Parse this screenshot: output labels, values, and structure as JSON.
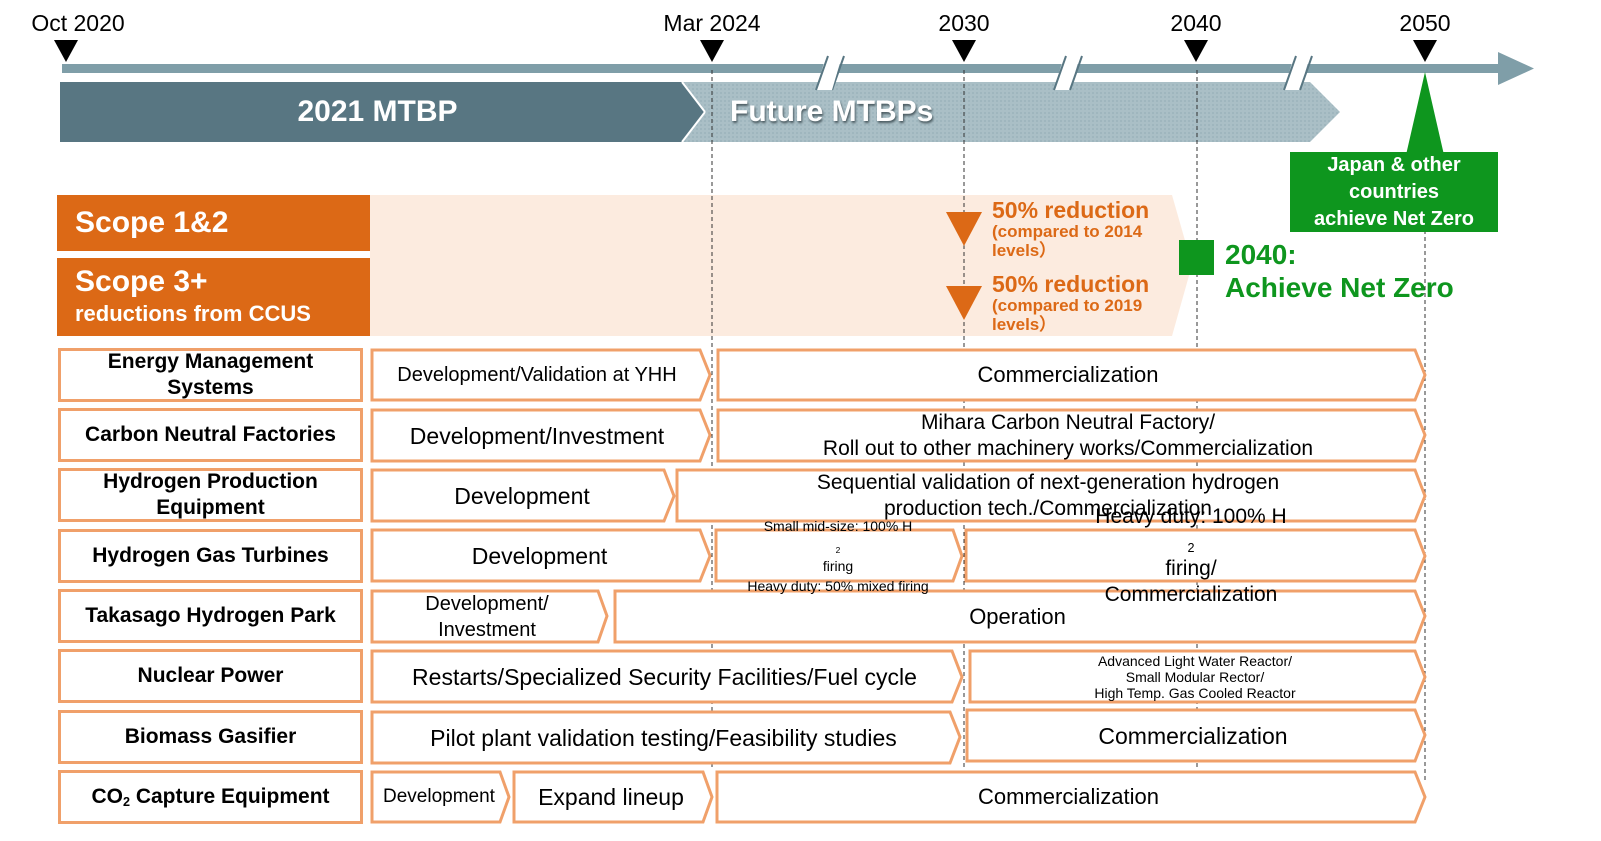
{
  "timeline": {
    "milestones": [
      {
        "label": "Oct 2020"
      },
      {
        "label": "Mar 2024"
      },
      {
        "label": "2030"
      },
      {
        "label": "2040"
      },
      {
        "label": "2050"
      }
    ],
    "axis_breaks": 3
  },
  "plans": {
    "current": "2021 MTBP",
    "future": "Future MTBPs"
  },
  "scopes": {
    "scope12": {
      "title": "Scope 1&2",
      "target_title": "50% reduction",
      "target_note": "(compared to 2014 levels)",
      "target_note_line1": "(compared to 2014",
      "target_note_line2": "levels）"
    },
    "scope3": {
      "title": "Scope 3+",
      "subtitle": "reductions from CCUS",
      "target_title": "50% reduction",
      "target_note_line1": "(compared to 2019",
      "target_note_line2": "levels）"
    }
  },
  "netzero": {
    "company_line1": "2040:",
    "company_line2": "Achieve Net Zero",
    "global_line1": "Japan & other",
    "global_line2": "countries",
    "global_line3": "achieve Net Zero"
  },
  "colors": {
    "scope_orange": "#dc6916",
    "scope_band": "#fcebdf",
    "segment_border": "#f0a06a",
    "current_plan": "#587682",
    "future_plan": "#aabfc6",
    "axis": "#7f9ea8",
    "net_zero_green": "#0e961e"
  },
  "rows": [
    {
      "label_line1": "Energy Management",
      "label_line2": "Systems",
      "segments": [
        {
          "text": "Development/Validation  at YHH"
        },
        {
          "text": "Commercialization"
        }
      ]
    },
    {
      "label_line1": "Carbon Neutral Factories",
      "segments": [
        {
          "text": "Development/Investment"
        },
        {
          "line1": "Mihara Carbon Neutral Factory/",
          "line2": "Roll out to other machinery works/Commercialization"
        }
      ]
    },
    {
      "label_line1": "Hydrogen Production",
      "label_line2": "Equipment",
      "segments": [
        {
          "text": "Development"
        },
        {
          "line1": "Sequential  validation  of next-generation  hydrogen",
          "line2": "production  tech./Commercialization"
        }
      ]
    },
    {
      "label_line1": "Hydrogen Gas Turbines",
      "segments": [
        {
          "text": "Development"
        },
        {
          "line1_pre": "Small mid-size: 100% H",
          "line1_sub": "2",
          "line1_post": " firing",
          "line2": "Heavy duty: 50% mixed firing"
        },
        {
          "line1_pre": "Heavy duty:  100% H",
          "line1_sub": "2",
          "line1_post": " firing/",
          "line2": "Commercialization"
        }
      ]
    },
    {
      "label_line1": "Takasago Hydrogen Park",
      "segments": [
        {
          "line1": "Development/",
          "line2": "Investment"
        },
        {
          "text": "Operation"
        }
      ]
    },
    {
      "label_line1": "Nuclear Power",
      "segments": [
        {
          "text": "Restarts/Specialized Security Facilities/Fuel cycle"
        },
        {
          "line1": "Advanced  Light  Water Reactor/",
          "line2": "Small Modular  Rector/",
          "line3": "High Temp.  Gas  Cooled Reactor"
        }
      ]
    },
    {
      "label_line1": "Biomass Gasifier",
      "segments": [
        {
          "text": "Pilot plant validation testing/Feasibility studies"
        },
        {
          "text": "Commercialization"
        }
      ]
    },
    {
      "label_pre": "CO",
      "label_sub": "2",
      "label_post": " Capture Equipment",
      "segments": [
        {
          "text": "Development"
        },
        {
          "text": "Expand lineup"
        },
        {
          "text": "Commercialization"
        }
      ]
    }
  ]
}
